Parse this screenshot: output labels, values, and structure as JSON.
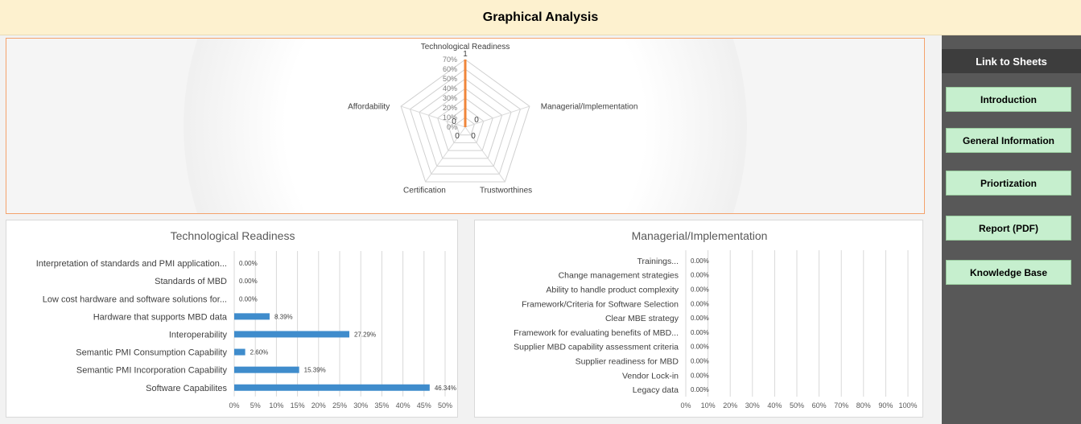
{
  "header": {
    "title": "Graphical Analysis"
  },
  "sidebar": {
    "title": "Link to Sheets",
    "buttons": [
      {
        "label": "Introduction"
      },
      {
        "label": "General Information"
      },
      {
        "label": "Priortization"
      },
      {
        "label": "Report (PDF)"
      },
      {
        "label": "Knowledge Base"
      }
    ]
  },
  "colors": {
    "radar_series": "#f0863a",
    "bar_series": "#3f8ccc",
    "radar_border": "#f4a26c",
    "header_bg": "#fdf1cf",
    "button_bg": "#c6efce"
  },
  "chart_data": [
    {
      "type": "radar",
      "categories": [
        "Technological Readiness",
        "Managerial/Implementation",
        "Trustworthines",
        "Certification",
        "Affordability"
      ],
      "values": [
        1,
        0,
        0,
        0,
        0
      ],
      "data_labels": [
        "1",
        "0",
        "0",
        "0",
        "0"
      ],
      "tick_labels": [
        "0%",
        "10%",
        "20%",
        "30%",
        "40%",
        "50%",
        "60%",
        "70%"
      ],
      "rlim": [
        0,
        0.7
      ],
      "grid": true
    },
    {
      "type": "bar",
      "orientation": "horizontal",
      "title": "Technological Readiness",
      "categories": [
        "Interpretation of standards and PMI application...",
        "Standards of MBD",
        "Low cost hardware and software solutions for...",
        "Hardware that supports MBD data",
        "Interoperability",
        "Semantic PMI Consumption Capability",
        "Semantic PMI Incorporation Capability",
        "Software Capabilites"
      ],
      "values": [
        0,
        0,
        0,
        8.39,
        27.29,
        2.6,
        15.39,
        46.34
      ],
      "data_labels": [
        "0.00%",
        "0.00%",
        "0.00%",
        "8.39%",
        "27.29%",
        "2.60%",
        "15.39%",
        "46.34%"
      ],
      "tick_labels": [
        "0%",
        "5%",
        "10%",
        "15%",
        "20%",
        "25%",
        "30%",
        "35%",
        "40%",
        "45%",
        "50%"
      ],
      "xlim": [
        0,
        50
      ],
      "grid": true
    },
    {
      "type": "bar",
      "orientation": "horizontal",
      "title": "Managerial/Implementation",
      "categories": [
        "Trainings...",
        "Change management strategies",
        "Ability to handle product complexity",
        "Framework/Criteria for Software Selection",
        "Clear MBE strategy",
        "Framework for evaluating benefits of MBD...",
        "Supplier MBD capability assessment criteria",
        "Supplier readiness for MBD",
        "Vendor Lock-in",
        "Legacy data"
      ],
      "values": [
        0,
        0,
        0,
        0,
        0,
        0,
        0,
        0,
        0,
        0
      ],
      "data_labels": [
        "0.00%",
        "0.00%",
        "0.00%",
        "0.00%",
        "0.00%",
        "0.00%",
        "0.00%",
        "0.00%",
        "0.00%",
        "0.00%"
      ],
      "tick_labels": [
        "0%",
        "10%",
        "20%",
        "30%",
        "40%",
        "50%",
        "60%",
        "70%",
        "80%",
        "90%",
        "100%"
      ],
      "xlim": [
        0,
        100
      ],
      "grid": true
    }
  ]
}
